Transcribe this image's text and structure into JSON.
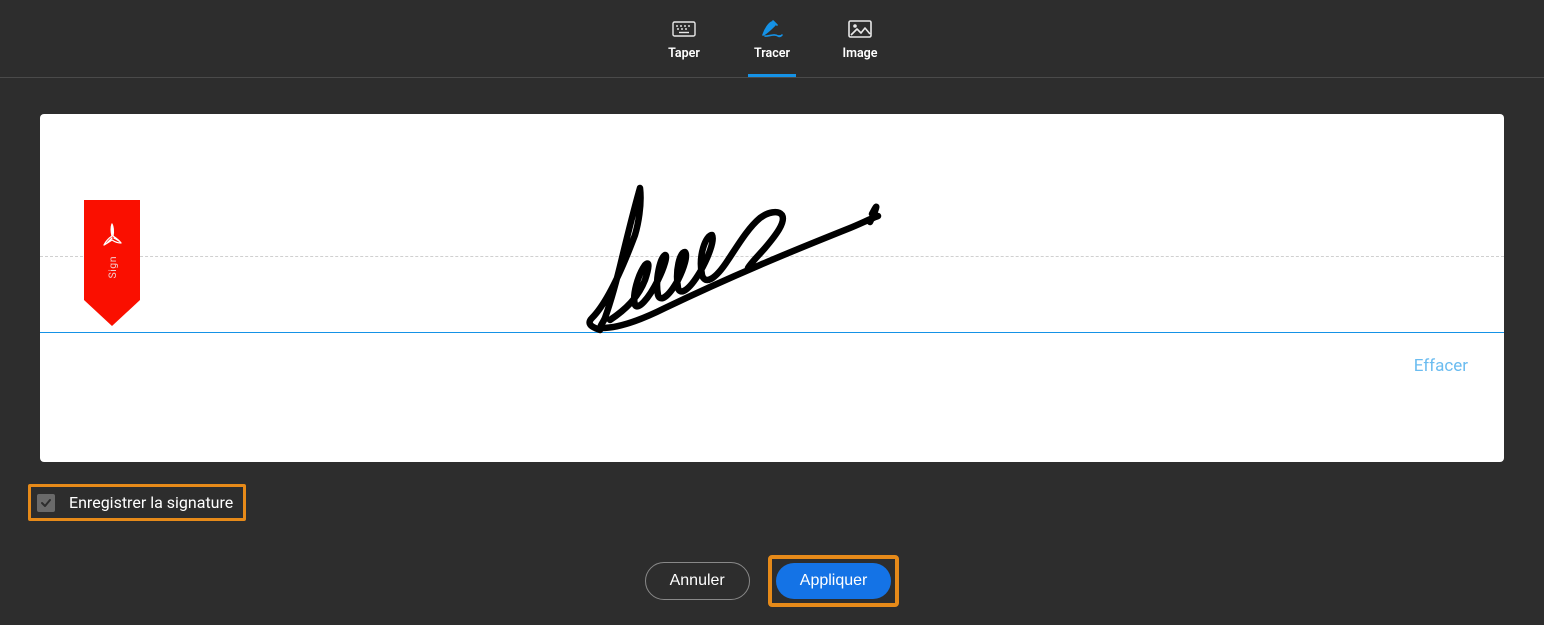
{
  "tabs": {
    "type_label": "Taper",
    "draw_label": "Tracer",
    "image_label": "Image",
    "active": "draw"
  },
  "marker": {
    "sign_text": "Sign"
  },
  "actions": {
    "clear_label": "Effacer"
  },
  "save": {
    "label": "Enregistrer la signature",
    "checked": true
  },
  "buttons": {
    "cancel_label": "Annuler",
    "apply_label": "Appliquer"
  }
}
